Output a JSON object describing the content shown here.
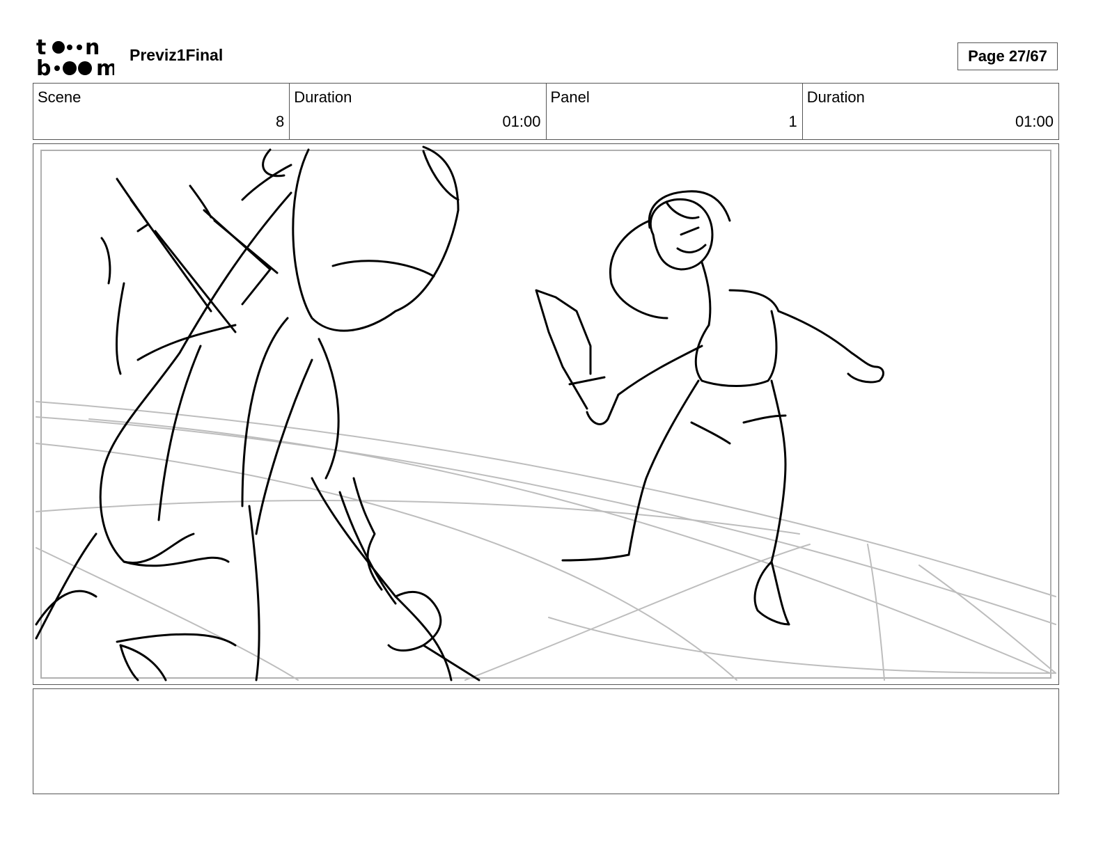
{
  "header": {
    "project_title": "Previz1Final",
    "page_label": "Page 27/67",
    "logo_top": "t  n",
    "logo_bottom": "b  m"
  },
  "info": {
    "scene_label": "Scene",
    "scene_value": "8",
    "scene_duration_label": "Duration",
    "scene_duration_value": "01:00",
    "panel_label": "Panel",
    "panel_value": "1",
    "panel_duration_label": "Duration",
    "panel_duration_value": "01:00"
  },
  "notes": {
    "text": ""
  }
}
